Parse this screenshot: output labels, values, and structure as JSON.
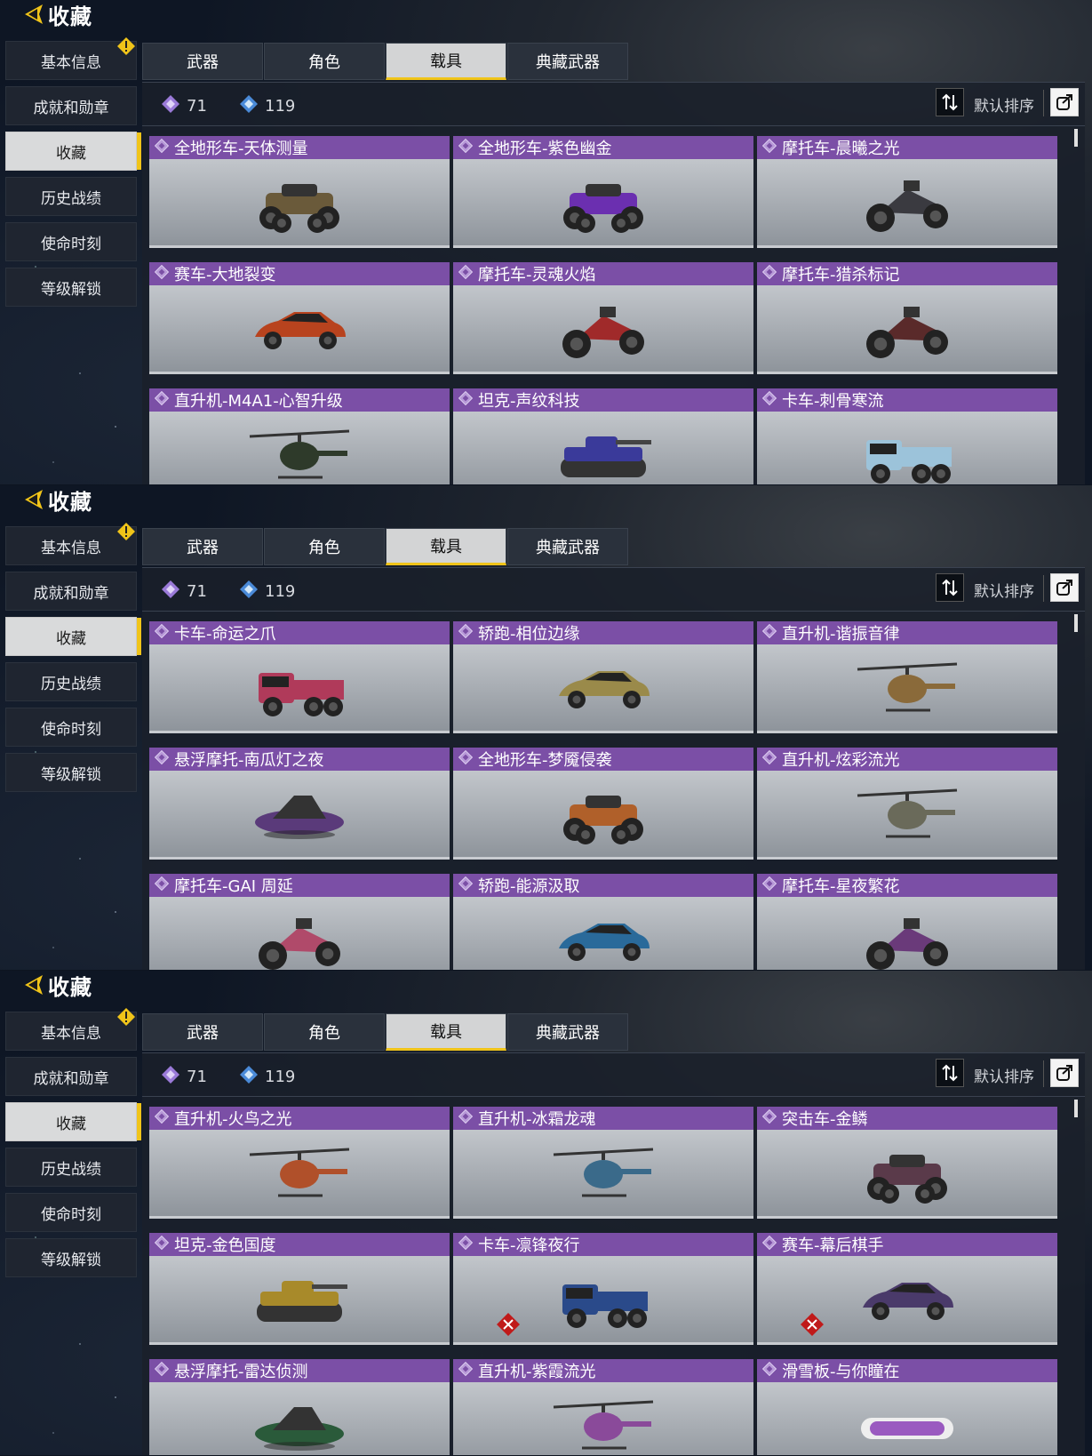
{
  "header": {
    "title": "收藏"
  },
  "sidebar": {
    "items": [
      {
        "label": "基本信息",
        "alert": true
      },
      {
        "label": "成就和勋章"
      },
      {
        "label": "收藏",
        "active": true
      },
      {
        "label": "历史战绩"
      },
      {
        "label": "使命时刻"
      },
      {
        "label": "等级解锁"
      }
    ]
  },
  "tabs": [
    {
      "label": "武器"
    },
    {
      "label": "角色"
    },
    {
      "label": "载具",
      "active": true
    },
    {
      "label": "典藏武器"
    }
  ],
  "toolbar": {
    "count_purple": "71",
    "count_blue": "119",
    "sort_label": "默认排序",
    "sort_icon": "sort-icon",
    "share_icon": "share-icon"
  },
  "colors": {
    "accent": "#f0c419",
    "card_header": "#7b4fa6"
  },
  "panels": [
    {
      "cards": [
        {
          "name": "全地形车-天体测量",
          "vehicle": "atv",
          "color": "#6a5a3a"
        },
        {
          "name": "全地形车-紫色幽金",
          "vehicle": "atv",
          "color": "#6b2fb0"
        },
        {
          "name": "摩托车-晨曦之光",
          "vehicle": "moto",
          "color": "#3a3a40"
        },
        {
          "name": "赛车-大地裂变",
          "vehicle": "car",
          "color": "#b8431e"
        },
        {
          "name": "摩托车-灵魂火焰",
          "vehicle": "moto",
          "color": "#a02a2a"
        },
        {
          "name": "摩托车-猎杀标记",
          "vehicle": "moto",
          "color": "#5a2a2a"
        },
        {
          "name": "直升机-M4A1-心智升级",
          "vehicle": "heli",
          "color": "#2e3a2a"
        },
        {
          "name": "坦克-声纹科技",
          "vehicle": "tank",
          "color": "#3a3a9a"
        },
        {
          "name": "卡车-刺骨寒流",
          "vehicle": "truck",
          "color": "#9cc3da"
        }
      ]
    },
    {
      "cards": [
        {
          "name": "卡车-命运之爪",
          "vehicle": "truck",
          "color": "#b03a5a"
        },
        {
          "name": "轿跑-相位边缘",
          "vehicle": "car",
          "color": "#9a8a4a"
        },
        {
          "name": "直升机-谐振音律",
          "vehicle": "heli",
          "color": "#8a6a3a"
        },
        {
          "name": "悬浮摩托-南瓜灯之夜",
          "vehicle": "hover",
          "color": "#5a3a7a"
        },
        {
          "name": "全地形车-梦魇侵袭",
          "vehicle": "atv",
          "color": "#b0602a"
        },
        {
          "name": "直升机-炫彩流光",
          "vehicle": "heli",
          "color": "#6a6a5a"
        },
        {
          "name": "摩托车-GAI 周延",
          "vehicle": "moto",
          "color": "#b04a6a"
        },
        {
          "name": "轿跑-能源汲取",
          "vehicle": "car",
          "color": "#2a6a9a"
        },
        {
          "name": "摩托车-星夜繁花",
          "vehicle": "moto",
          "color": "#6a3a7a"
        }
      ]
    },
    {
      "cards": [
        {
          "name": "直升机-火鸟之光",
          "vehicle": "heli",
          "color": "#b0502a"
        },
        {
          "name": "直升机-冰霜龙魂",
          "vehicle": "heli",
          "color": "#3a6a8a"
        },
        {
          "name": "突击车-金鳞",
          "vehicle": "atv",
          "color": "#5a3a4a"
        },
        {
          "name": "坦克-金色国度",
          "vehicle": "tank",
          "color": "#a88a2a"
        },
        {
          "name": "卡车-凛锋夜行",
          "vehicle": "truck",
          "color": "#2a4a8a",
          "locked": true
        },
        {
          "name": "赛车-幕后棋手",
          "vehicle": "car",
          "color": "#4a3a6a",
          "locked": true
        },
        {
          "name": "悬浮摩托-雷达侦测",
          "vehicle": "hover",
          "color": "#2a5a3a"
        },
        {
          "name": "直升机-紫霞流光",
          "vehicle": "heli",
          "color": "#8a4a9a"
        },
        {
          "name": "滑雪板-与你瞳在",
          "vehicle": "board",
          "color": "#9a5ac0"
        }
      ]
    }
  ]
}
